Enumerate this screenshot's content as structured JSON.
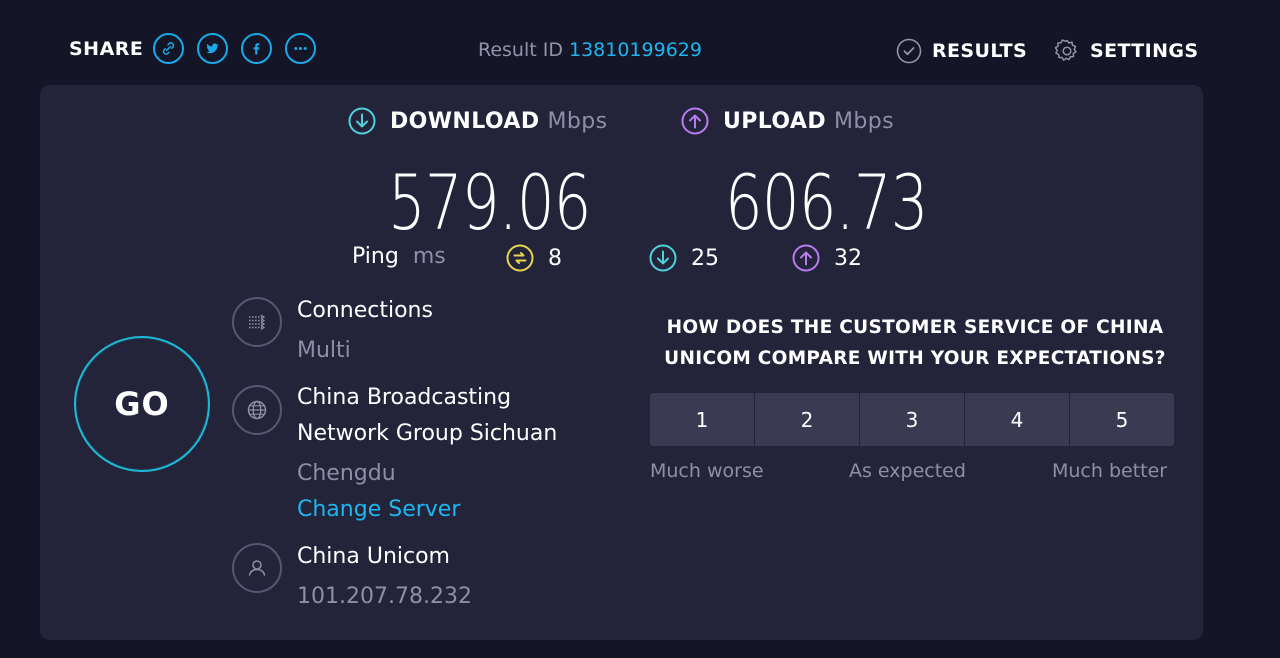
{
  "header": {
    "share_label": "SHARE",
    "share_icons": [
      "link-icon",
      "twitter-icon",
      "facebook-icon",
      "more-icon"
    ],
    "result_id_label": "Result ID",
    "result_id": "13810199629",
    "results_label": "RESULTS",
    "settings_label": "SETTINGS"
  },
  "download": {
    "label": "DOWNLOAD",
    "unit": "Mbps",
    "value": "579.06"
  },
  "upload": {
    "label": "UPLOAD",
    "unit": "Mbps",
    "value": "606.73"
  },
  "ping": {
    "label": "Ping",
    "unit": "ms",
    "idle": "8",
    "download": "25",
    "upload": "32"
  },
  "go_label": "GO",
  "connections": {
    "title": "Connections",
    "value": "Multi"
  },
  "server": {
    "name_line1": "China Broadcasting",
    "name_line2": "Network Group Sichuan",
    "location": "Chengdu",
    "change_label": "Change Server"
  },
  "provider": {
    "name": "China Unicom",
    "ip": "101.207.78.232"
  },
  "survey": {
    "question_line1": "HOW DOES THE CUSTOMER SERVICE OF CHINA",
    "question_line2": "UNICOM COMPARE WITH YOUR EXPECTATIONS?",
    "options": [
      "1",
      "2",
      "3",
      "4",
      "5"
    ],
    "low_label": "Much worse",
    "mid_label": "As expected",
    "high_label": "Much better"
  },
  "colors": {
    "accent": "#1fb5f0",
    "download": "#4fd1d9",
    "upload": "#b67cf0",
    "ping": "#e7d552",
    "background": "#141526",
    "panel": "#23243a"
  }
}
